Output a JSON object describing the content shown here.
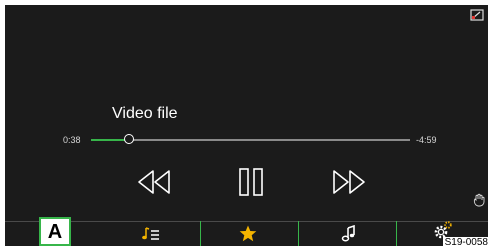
{
  "player": {
    "title": "Video file",
    "elapsed": "0:38",
    "remaining": "-4:59",
    "progress_fraction": 0.12
  },
  "controls": {
    "previous_icon": "rewind-icon",
    "pause_icon": "pause-icon",
    "next_icon": "fast-forward-icon"
  },
  "indicators": {
    "top_right_icon": "screen-toggle-icon",
    "bottom_right_icon": "hand-gesture-icon"
  },
  "bottom_bar": {
    "tabs": [
      {
        "icon": "playlist-icon"
      },
      {
        "icon": "star-icon"
      },
      {
        "icon": "music-note-icon"
      },
      {
        "icon": "settings-icon"
      }
    ]
  },
  "callout": {
    "label": "A"
  },
  "figure_code": "S19-0058",
  "colors": {
    "background": "#1b1b1b",
    "accent": "#37b54a",
    "star": "#f4b400"
  }
}
